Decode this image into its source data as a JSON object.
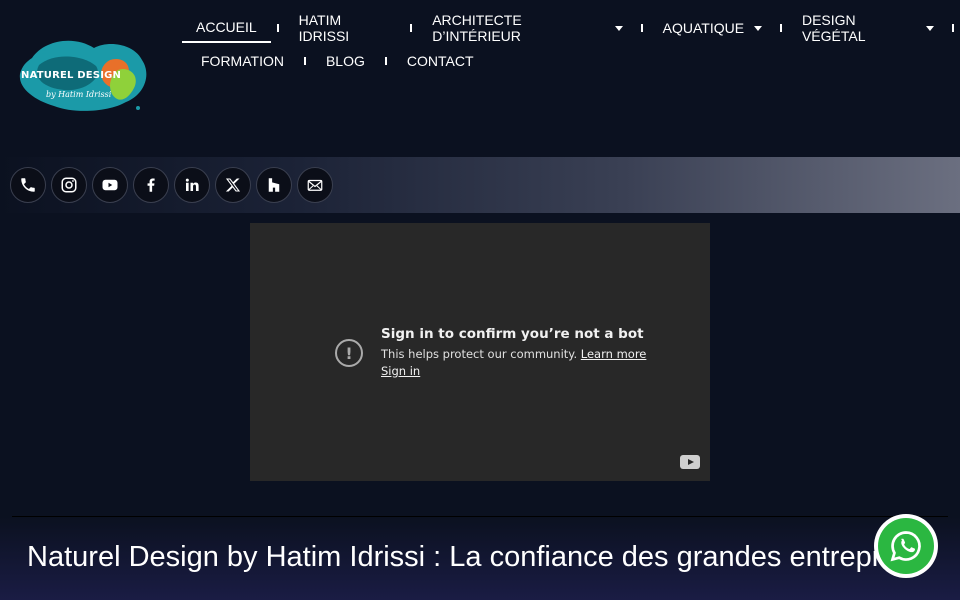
{
  "logo": {
    "title": "NATUREL DESIGN",
    "subtitle": "by Hatim Idrissi"
  },
  "nav": {
    "row1": [
      {
        "label": "ACCUEIL",
        "active": true,
        "dropdown": false
      },
      {
        "label": "HATIM IDRISSI",
        "dropdown": false
      },
      {
        "label": "ARCHITECTE D’INTÉRIEUR",
        "dropdown": true
      },
      {
        "label": "AQUATIQUE",
        "dropdown": true
      },
      {
        "label": "DESIGN VÉGÉTAL",
        "dropdown": true
      }
    ],
    "row2": [
      {
        "label": "FORMATION"
      },
      {
        "label": "BLOG"
      },
      {
        "label": "CONTACT"
      }
    ]
  },
  "social": [
    "phone-icon",
    "instagram-icon",
    "youtube-icon",
    "facebook-icon",
    "linkedin-icon",
    "x-icon",
    "houzz-icon",
    "mail-icon"
  ],
  "video": {
    "title": "Sign in to confirm you’re not a bot",
    "message": "This helps protect our community.",
    "learn_more": "Learn more",
    "sign_in": "Sign in"
  },
  "headline": "Naturel Design by Hatim Idrissi : La confiance des grandes entreprises",
  "colors": {
    "background": "#0b1120",
    "whatsapp": "#2bb741"
  }
}
